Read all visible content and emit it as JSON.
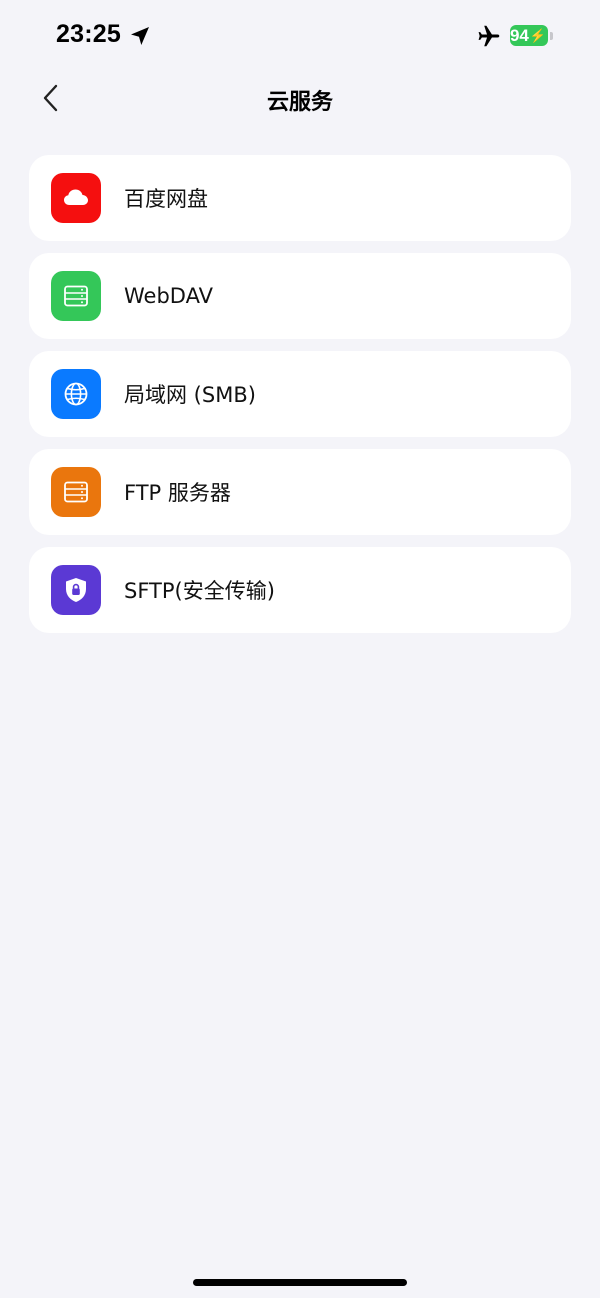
{
  "status_bar": {
    "time": "23:25",
    "battery_level": "94",
    "battery_charging": true,
    "airplane_mode": true,
    "location_icon": "location-arrow-icon",
    "battery_color": "#34c759"
  },
  "nav": {
    "title": "云服务",
    "back_icon": "chevron-left-icon"
  },
  "services": [
    {
      "label": "百度网盘",
      "icon": "cloud-icon",
      "color": "#f50f0f"
    },
    {
      "label": "WebDAV",
      "icon": "server-icon",
      "color": "#34c759"
    },
    {
      "label": "局域网 (SMB)",
      "icon": "globe-icon",
      "color": "#0a7aff"
    },
    {
      "label": "FTP 服务器",
      "icon": "server-icon",
      "color": "#ea760d"
    },
    {
      "label": "SFTP(安全传输)",
      "icon": "shield-lock-icon",
      "color": "#5b39d4"
    }
  ],
  "colors": {
    "background": "#f4f4f9",
    "card": "#ffffff"
  }
}
